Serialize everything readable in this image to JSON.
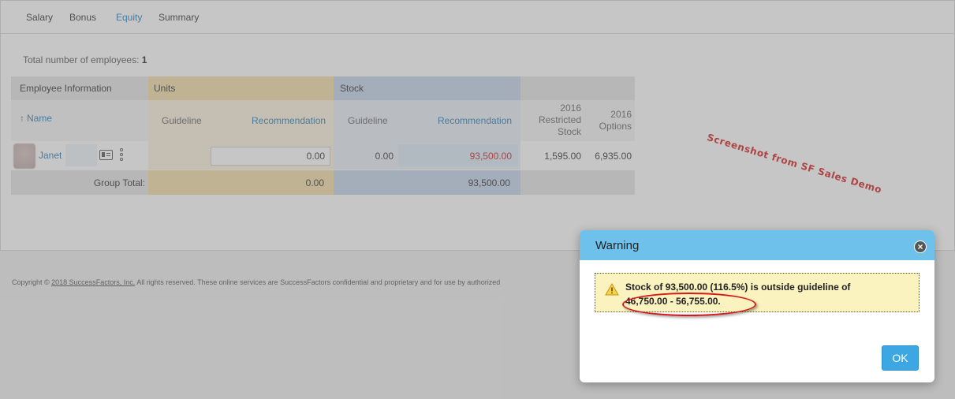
{
  "tabs": [
    {
      "label": "Salary"
    },
    {
      "label": "Bonus"
    },
    {
      "label": "Equity",
      "active": true
    },
    {
      "label": "Summary"
    }
  ],
  "summary": {
    "total_label": "Total number of employees:",
    "total_value": "1"
  },
  "table": {
    "group_headers": {
      "info": "Employee Information",
      "units": "Units",
      "stock": "Stock"
    },
    "columns": {
      "name": "Name",
      "units_guideline": "Guideline",
      "units_recommendation": "Recommendation",
      "stock_guideline": "Guideline",
      "stock_recommendation": "Recommendation",
      "restricted_line1": "2016",
      "restricted_line2": "Restricted",
      "restricted_line3": "Stock",
      "options_line1": "2016",
      "options_line2": "Options"
    },
    "row": {
      "name": "Janet",
      "units_recommendation": "0.00",
      "stock_guideline": "0.00",
      "stock_recommendation": "93,500.00",
      "restricted_stock": "1,595.00",
      "options": "6,935.00"
    },
    "group_total": {
      "label": "Group Total:",
      "units": "0.00",
      "stock": "93,500.00"
    }
  },
  "watermark": "Screenshot from SF Sales Demo",
  "footer": {
    "copyright_prefix": "Copyright © ",
    "copyright_link": "2018 SuccessFactors, Inc.",
    "copyright_suffix": " All rights reserved. These online services are SuccessFactors confidential and proprietary and for use by authorized"
  },
  "dialog": {
    "title": "Warning",
    "message_line1": "Stock of 93,500.00 (116.5%) is outside guideline of",
    "message_line2": "46,750.00 - 56,755.00.",
    "ok_label": "OK",
    "close_icon": "close-icon",
    "warning_icon": "warning-triangle-icon"
  },
  "colors": {
    "accent": "#2a7fb8",
    "dialog_header": "#6ec1ea",
    "warning_bg": "#faf2bf",
    "over_guideline": "#d62020",
    "units_header": "#f3dfa9",
    "stock_header": "#c4d6eb"
  }
}
